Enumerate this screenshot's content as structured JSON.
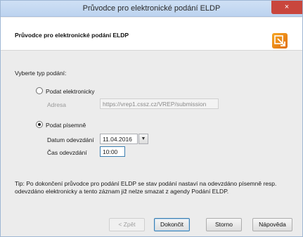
{
  "window": {
    "title": "Průvodce pro elektronické podání ELDP",
    "close_glyph": "×"
  },
  "header": {
    "title": "Průvodce pro elektronické podání ELDP",
    "icon": "wizard-icon"
  },
  "form": {
    "section_label": "Vyberte typ podání:",
    "electronic": {
      "label": "Podat elektronicky",
      "selected": false,
      "address_label": "Adresa",
      "address_value": "https://vrep1.cssz.cz/VREP/submission"
    },
    "paper": {
      "label": "Podat písemně",
      "selected": true,
      "date_label": "Datum odevzdání",
      "date_value": "11.04.2016",
      "time_label": "Čas odevzdání",
      "time_value": "10:00"
    },
    "tip": "Tip: Po dokončení průvodce pro podání ELDP se stav podání nastaví na odevzdáno písemně resp. odevzdáno elektronicky a tento záznam již nelze smazat z agendy Podání ELDP."
  },
  "buttons": {
    "back": "< Zpět",
    "finish": "Dokončit",
    "cancel": "Storno",
    "help": "Nápověda"
  }
}
